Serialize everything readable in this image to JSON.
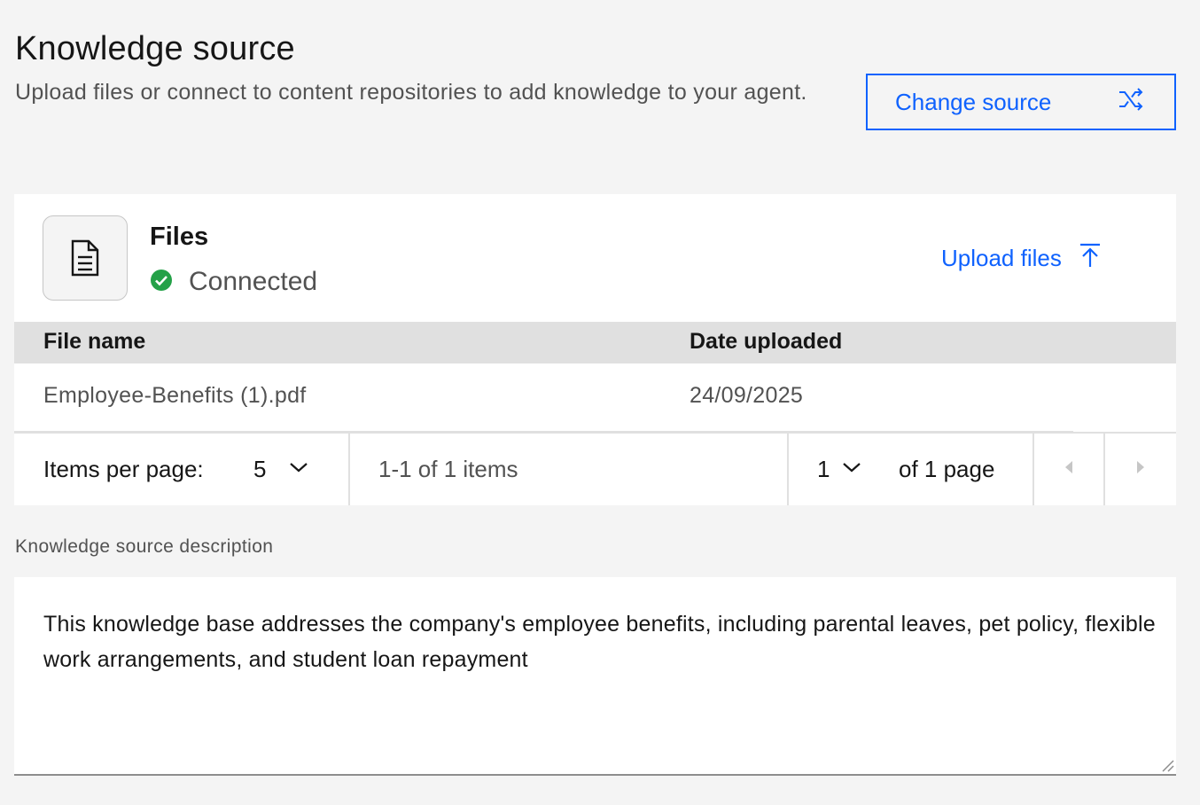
{
  "header": {
    "title": "Knowledge source",
    "subtitle": "Upload files or connect to content repositories to add knowledge to your agent.",
    "change_source_label": "Change source"
  },
  "files_card": {
    "title": "Files",
    "status": "Connected",
    "upload_label": "Upload files",
    "status_color": "#24a148"
  },
  "table": {
    "columns": [
      "File name",
      "Date uploaded"
    ],
    "rows": [
      {
        "file_name": "Employee-Benefits (1).pdf",
        "date_uploaded": "24/09/2025"
      }
    ]
  },
  "pagination": {
    "items_per_page_label": "Items per page:",
    "items_per_page_value": "5",
    "range_text": "1-1 of 1 items",
    "page_value": "1",
    "page_total_text": "of 1 page"
  },
  "description": {
    "label": "Knowledge source description",
    "value": "This knowledge base addresses the company's employee benefits, including parental leaves, pet policy, flexible work arrangements, and student loan repayment"
  },
  "colors": {
    "accent": "#0f62fe",
    "background": "#f4f4f4"
  }
}
